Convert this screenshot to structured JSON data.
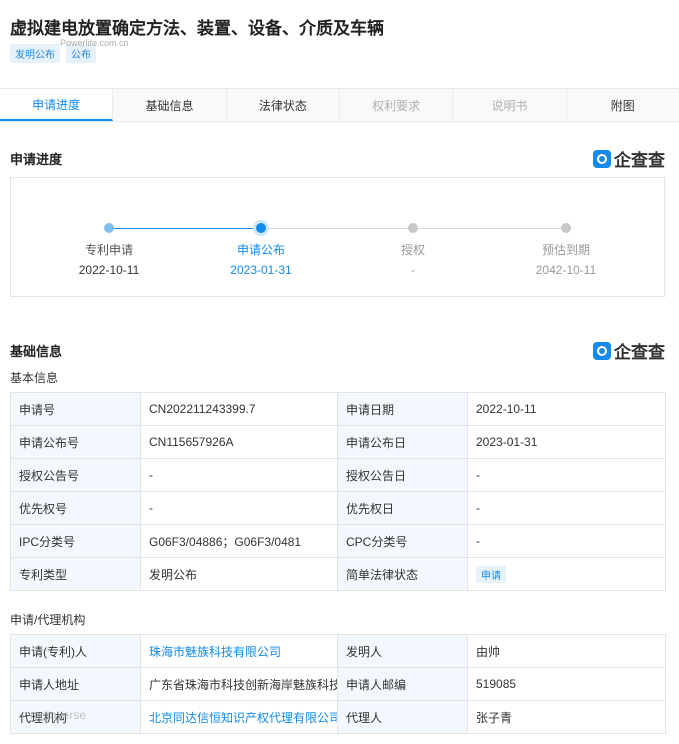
{
  "header": {
    "title": "虚拟建电放置确定方法、装置、设备、介质及车辆",
    "tags": [
      "发明公布",
      "公布"
    ]
  },
  "tabs": [
    {
      "label": "申请进度",
      "state": "active"
    },
    {
      "label": "基础信息",
      "state": "normal"
    },
    {
      "label": "法律状态",
      "state": "normal"
    },
    {
      "label": "权利要求",
      "state": "disabled"
    },
    {
      "label": "说明书",
      "state": "disabled"
    },
    {
      "label": "附图",
      "state": "normal"
    }
  ],
  "brand": {
    "name": "企查查",
    "icon": "qcc-logo-icon"
  },
  "progress": {
    "heading": "申请进度",
    "steps": [
      {
        "label": "专利申请",
        "date": "2022-10-11",
        "state": "done"
      },
      {
        "label": "申请公布",
        "date": "2023-01-31",
        "state": "current"
      },
      {
        "label": "授权",
        "date": "-",
        "state": "future"
      },
      {
        "label": "预估到期",
        "date": "2042-10-11",
        "state": "future"
      }
    ]
  },
  "basic": {
    "heading": "基础信息",
    "subheading": "基本信息",
    "rows": [
      [
        "申请号",
        "CN202211243399.7",
        "申请日期",
        "2022-10-11"
      ],
      [
        "申请公布号",
        "CN115657926A",
        "申请公布日",
        "2023-01-31"
      ],
      [
        "授权公告号",
        "-",
        "授权公告日",
        "-"
      ],
      [
        "优先权号",
        "-",
        "优先权日",
        "-"
      ],
      [
        "IPC分类号",
        "G06F3/04886；G06F3/0481",
        "CPC分类号",
        "-"
      ],
      [
        "专利类型",
        "发明公布",
        "简单法律状态",
        "申请"
      ]
    ]
  },
  "agency": {
    "subheading": "申请/代理机构",
    "rows": [
      [
        "申请(专利)人",
        "珠海市魅族科技有限公司",
        "发明人",
        "由帅"
      ],
      [
        "申请人地址",
        "广东省珠海市科技创新海岸魅族科技楼",
        "申请人邮编",
        "519085"
      ],
      [
        "代理机构",
        "北京同达信恒知识产权代理有限公司",
        "代理人",
        "张子青"
      ]
    ]
  },
  "watermarks": [
    "Powerlife.com.cn",
    "metaverse"
  ],
  "colors": {
    "accent": "#128bed",
    "key_cell_bg": "#f2f8fd",
    "tag_bg": "#e6f2fb"
  }
}
